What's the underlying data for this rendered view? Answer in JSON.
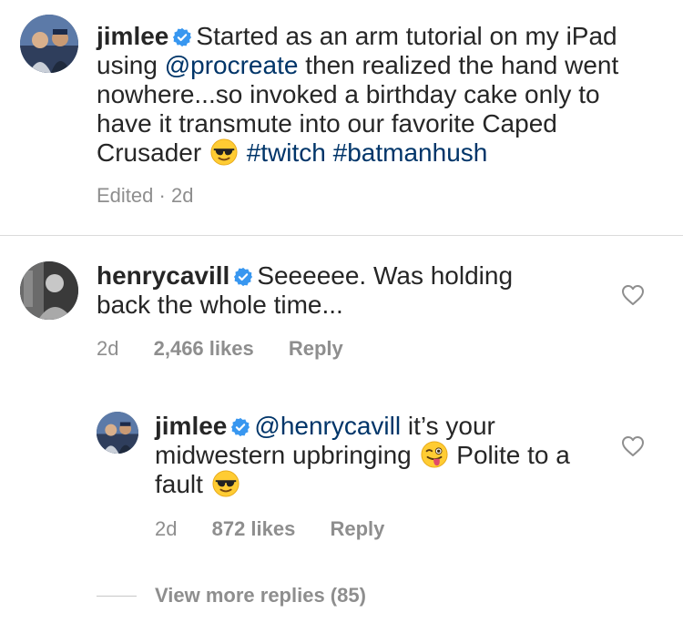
{
  "comments": [
    {
      "username": "jimlee",
      "segments": [
        {
          "text": "Started as an arm tutorial on my iPad using "
        },
        {
          "text": "@procreate",
          "link": true
        },
        {
          "text": " then realized the hand went nowhere...so invoked a birthday cake only to have it transmute into our favorite Caped Crusader "
        }
      ],
      "hashtags": [
        "#twitch",
        "#batmanhush"
      ],
      "meta": {
        "edited": "Edited",
        "sep": "·",
        "time": "2d"
      }
    },
    {
      "username": "henrycavill",
      "text": "Seeeeee. Was holding back the whole time...",
      "meta": {
        "time": "2d",
        "likes": "2,466 likes",
        "reply": "Reply"
      }
    },
    {
      "username": "jimlee",
      "mention": "@henrycavill",
      "text_a": " it’s your midwestern upbringing ",
      "text_b": " Polite to a fault ",
      "meta": {
        "time": "2d",
        "likes": "872 likes",
        "reply": "Reply"
      }
    }
  ],
  "view_more": "View more replies (85)",
  "colors": {
    "link": "#003569",
    "meta": "#8e8e8e",
    "verified": "#3897f0",
    "text": "#262626"
  },
  "icons": [
    "verified-badge-icon",
    "heart-outline-icon",
    "sunglasses-emoji-icon",
    "winking-tongue-emoji-icon"
  ]
}
